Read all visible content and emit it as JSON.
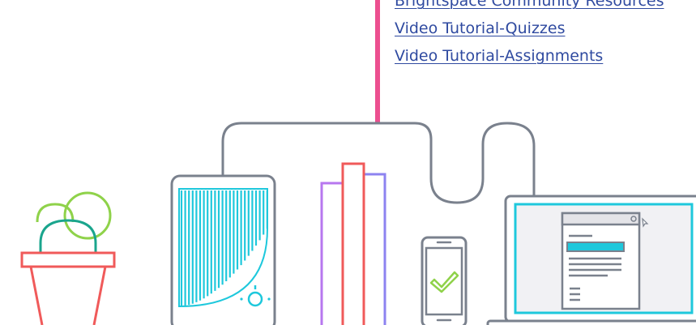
{
  "resources": {
    "links": [
      {
        "label": "Brightspace Community Resources"
      },
      {
        "label": "Video Tutorial-Quizzes "
      },
      {
        "label": "Video Tutorial-Assignments"
      }
    ]
  },
  "illustration": {
    "icons": [
      "cactus-plant-icon",
      "tablet-icon",
      "books-icon",
      "phone-checkmark-icon",
      "laptop-document-icon"
    ],
    "colors": {
      "accent_pink": "#ec4f8f",
      "outline_gray": "#7a818d",
      "cyan": "#1ec8dc",
      "coral": "#f05a5a",
      "green_dark": "#1aa58d",
      "green_light": "#8fd24a",
      "purple": "#b777ef",
      "lavender": "#8d83f0",
      "link_blue": "#2f4aa0"
    }
  }
}
